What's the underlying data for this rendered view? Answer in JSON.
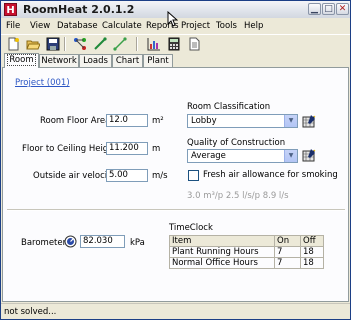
{
  "window": {
    "title": "RoomHeat 2.0.1.2"
  },
  "menu": [
    "File",
    "View",
    "Database",
    "Calculate",
    "Reports",
    "Project",
    "Tools",
    "Help"
  ],
  "tabs": [
    "Room",
    "Network",
    "Loads",
    "Chart",
    "Plant"
  ],
  "project_link": "Project (001)",
  "fields": {
    "floor_area": {
      "label": "Room Floor Area",
      "value": "12.0",
      "unit": "m²"
    },
    "ceiling_height": {
      "label": "Floor to Ceiling Height",
      "value": "11.200",
      "unit": "m"
    },
    "air_velocity": {
      "label": "Outside air velocity",
      "value": "5.00",
      "unit": "m/s"
    },
    "barometer": {
      "label": "Barometer",
      "value": "82.030",
      "unit": "kPa"
    }
  },
  "room_classification": {
    "label": "Room Classification",
    "value": "Lobby"
  },
  "quality_of_construction": {
    "label": "Quality of Construction",
    "value": "Average"
  },
  "smoking": {
    "label": "Fresh air allowance for smoking",
    "checked": false,
    "flow_text": "3.0 m³/p  2.5 l/s/p  8.9 l/s"
  },
  "timeclock": {
    "title": "TimeClock",
    "columns": [
      "Item",
      "On",
      "Off"
    ],
    "rows": [
      {
        "item": "Plant Running Hours",
        "on": "7",
        "off": "18"
      },
      {
        "item": "Normal Office Hours",
        "on": "7",
        "off": "18"
      }
    ]
  },
  "status": "not solved..."
}
